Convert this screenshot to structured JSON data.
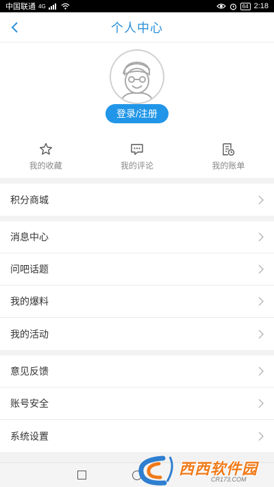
{
  "status_bar": {
    "carrier": "中国联通",
    "network": "4G",
    "battery": "64",
    "time": "2:18"
  },
  "header": {
    "title": "个人中心"
  },
  "profile": {
    "login_label": "登录/注册"
  },
  "quick_actions": [
    {
      "label": "我的收藏",
      "icon": "star-icon"
    },
    {
      "label": "我的评论",
      "icon": "comment-icon"
    },
    {
      "label": "我的账单",
      "icon": "bill-icon"
    }
  ],
  "menu_groups": [
    [
      {
        "label": "积分商城"
      }
    ],
    [
      {
        "label": "消息中心"
      },
      {
        "label": "问吧话题"
      },
      {
        "label": "我的爆料"
      },
      {
        "label": "我的活动"
      }
    ],
    [
      {
        "label": "意见反馈"
      },
      {
        "label": "账号安全"
      },
      {
        "label": "系统设置"
      }
    ]
  ],
  "watermark": {
    "brand": "西西软件园",
    "site": "CR173.COM"
  },
  "colors": {
    "accent": "#2a8fd9",
    "button": "#2196e8",
    "watermark": "#f07a18"
  }
}
